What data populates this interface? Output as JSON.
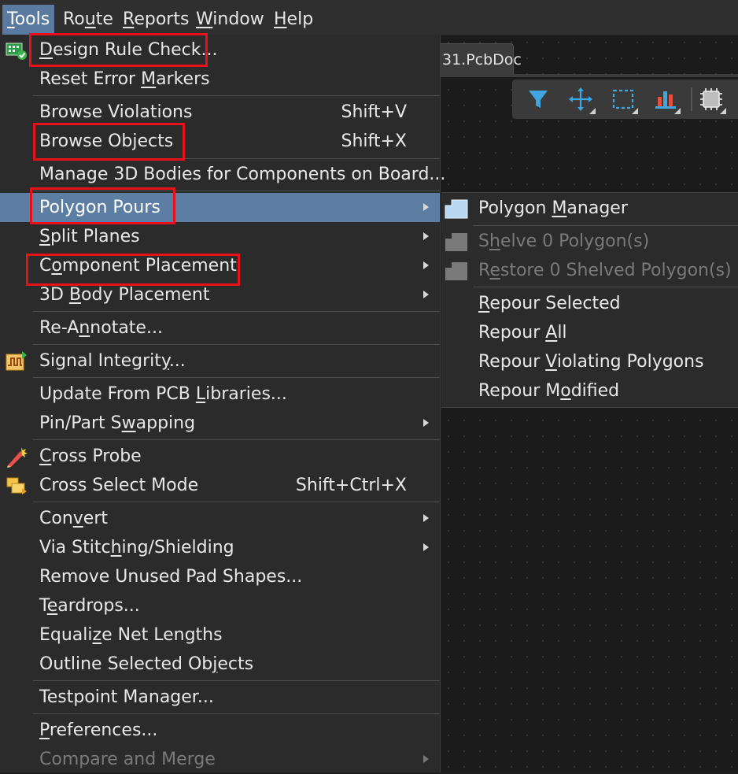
{
  "menubar": {
    "items": [
      {
        "pre": "",
        "u": "T",
        "post": "ools"
      },
      {
        "pre": "Ro",
        "u": "u",
        "post": "te"
      },
      {
        "pre": "",
        "u": "R",
        "post": "eports"
      },
      {
        "pre": "",
        "u": "W",
        "post": "indow"
      },
      {
        "pre": "",
        "u": "H",
        "post": "elp"
      }
    ]
  },
  "document": {
    "tab_label": "31.PcbDoc"
  },
  "toolbar": {
    "buttons": [
      "filter-icon",
      "move-icon",
      "select-rect-icon",
      "bar-chart-icon",
      "component-chip-icon"
    ]
  },
  "tools_menu": {
    "items": [
      {
        "pre": "",
        "u": "D",
        "post": "esign Rule Check...",
        "shortcut": "",
        "icon": "drc-icon"
      },
      {
        "pre": "Reset Error ",
        "u": "M",
        "post": "arkers",
        "shortcut": ""
      },
      {
        "pre": "Browse Violations",
        "u": "",
        "post": "",
        "shortcut": "Shift+V"
      },
      {
        "pre": "Browse Objects",
        "u": "",
        "post": "",
        "shortcut": "Shift+X"
      },
      {
        "pre": "Manage 3D Bodies for Components on Board...",
        "u": "",
        "post": "",
        "shortcut": ""
      },
      {
        "pre": "Polygon Pours",
        "u": "",
        "post": "",
        "shortcut": "",
        "submenu": true
      },
      {
        "pre": "",
        "u": "S",
        "post": "plit Planes",
        "shortcut": "",
        "submenu": true
      },
      {
        "pre": "C",
        "u": "o",
        "post": "mponent Placement",
        "shortcut": "",
        "submenu": true
      },
      {
        "pre": "3D ",
        "u": "B",
        "post": "ody Placement",
        "shortcut": "",
        "submenu": true
      },
      {
        "pre": "Re-A",
        "u": "n",
        "post": "notate...",
        "shortcut": ""
      },
      {
        "pre": "Signal Integrit",
        "u": "y",
        "post": "...",
        "shortcut": "",
        "icon": "signal-integrity-icon"
      },
      {
        "pre": "Update From PCB ",
        "u": "L",
        "post": "ibraries...",
        "shortcut": ""
      },
      {
        "pre": "Pin/Part S",
        "u": "w",
        "post": "apping",
        "shortcut": "",
        "submenu": true
      },
      {
        "pre": "",
        "u": "C",
        "post": "ross Probe",
        "shortcut": "",
        "icon": "cross-probe-icon"
      },
      {
        "pre": "Cross Select Mode",
        "u": "",
        "post": "",
        "shortcut": "Shift+Ctrl+X",
        "icon": "cross-select-icon"
      },
      {
        "pre": "Con",
        "u": "v",
        "post": "ert",
        "shortcut": "",
        "submenu": true
      },
      {
        "pre": "Via Stitc",
        "u": "h",
        "post": "ing/Shielding",
        "shortcut": "",
        "submenu": true
      },
      {
        "pre": "Remove Unused Pad Shapes...",
        "u": "",
        "post": "",
        "shortcut": ""
      },
      {
        "pre": "T",
        "u": "e",
        "post": "ardrops...",
        "shortcut": ""
      },
      {
        "pre": "Equali",
        "u": "z",
        "post": "e Net Lengths",
        "shortcut": ""
      },
      {
        "pre": "Outline Selected Ob",
        "u": "j",
        "post": "ects",
        "shortcut": ""
      },
      {
        "pre": "Testpoint Manager...",
        "u": "",
        "post": "",
        "shortcut": ""
      },
      {
        "pre": "",
        "u": "P",
        "post": "references...",
        "shortcut": ""
      },
      {
        "pre": "Compare and Merge",
        "u": "",
        "post": "",
        "shortcut": "",
        "submenu": true,
        "disabled": true
      }
    ]
  },
  "polygon_submenu": {
    "items": [
      {
        "pre": "Polygon ",
        "u": "M",
        "post": "anager",
        "icon": "polygon-icon"
      },
      {
        "pre": "S",
        "u": "h",
        "post": "elve 0 Polygon(s)",
        "icon": "polygon-icon",
        "disabled": true
      },
      {
        "pre": "R",
        "u": "e",
        "post": "store 0 Shelved Polygon(s)",
        "icon": "polygon-icon",
        "disabled": true
      },
      {
        "pre": "",
        "u": "R",
        "post": "epour Selected"
      },
      {
        "pre": "Repour ",
        "u": "A",
        "post": "ll"
      },
      {
        "pre": "Repour ",
        "u": "V",
        "post": "iolating Polygons"
      },
      {
        "pre": "Repour M",
        "u": "o",
        "post": "dified"
      }
    ]
  },
  "colors": {
    "highlight": "#5c7ea2",
    "annotation_box": "#e8101a",
    "menu_bg": "#2b2b2b"
  }
}
